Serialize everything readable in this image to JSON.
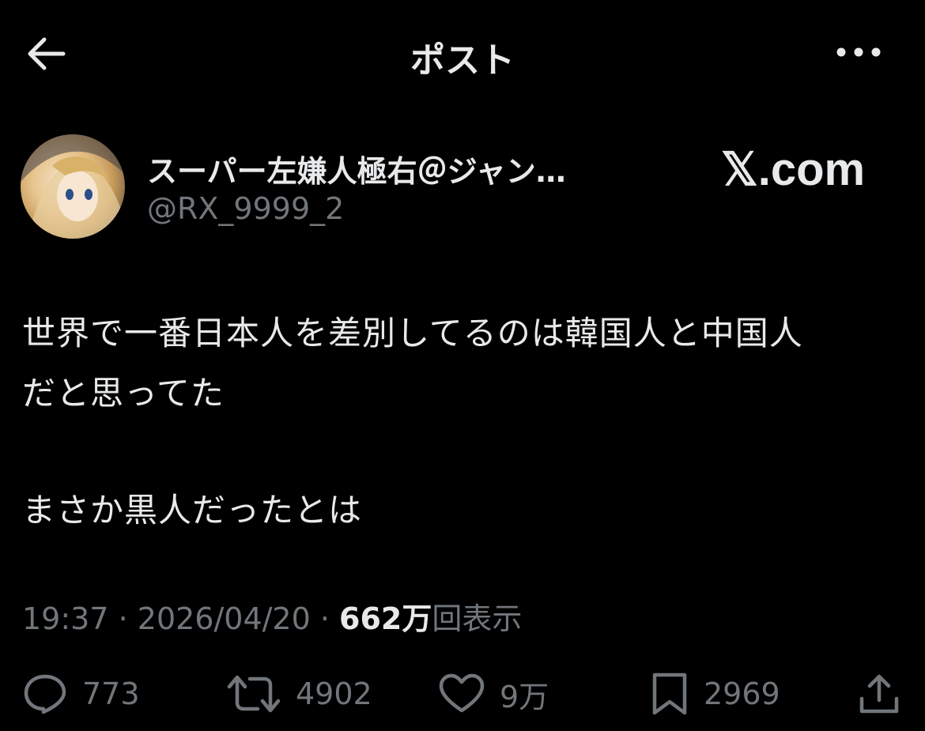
{
  "header": {
    "title": "ポスト",
    "back_icon": "arrow-left-icon",
    "more_icon": "more-horizontal-icon"
  },
  "author": {
    "display_name": "スーパー左嫌人極右＠ジャン…",
    "handle": "@RX_9999_2"
  },
  "brand": {
    "text": "𝕏.com"
  },
  "tweet": {
    "lines": [
      "世界で一番日本人を差別してるのは韓国人と中国人",
      "だと思ってた",
      "まさか黒人だったとは"
    ]
  },
  "meta": {
    "time": "19:37",
    "sep1": " · ",
    "date": "2026/04/20",
    "sep2": " · ",
    "views_count": "662万",
    "views_label": "回表示"
  },
  "actions": {
    "reply": {
      "icon": "reply-icon",
      "count": "773"
    },
    "retweet": {
      "icon": "retweet-icon",
      "count": "4902"
    },
    "like": {
      "icon": "heart-icon",
      "count": "9万"
    },
    "bookmark": {
      "icon": "bookmark-icon",
      "count": "2969"
    },
    "share": {
      "icon": "share-icon"
    }
  },
  "colors": {
    "background": "#000000",
    "text_primary": "#e7e9ea",
    "text_secondary": "#71767b"
  }
}
